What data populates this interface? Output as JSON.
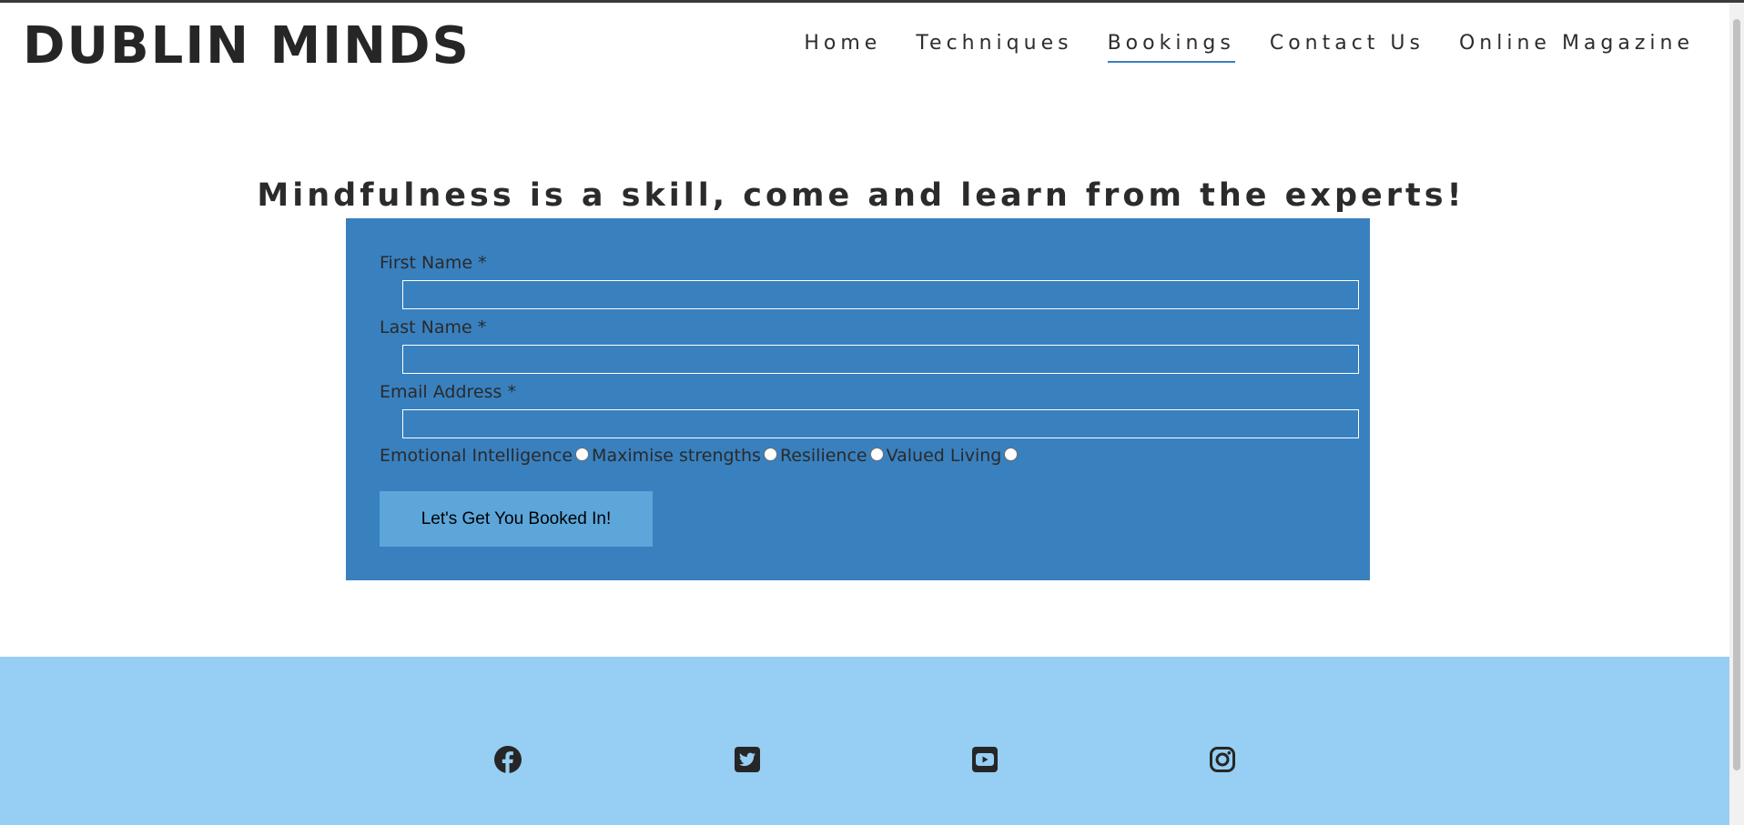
{
  "header": {
    "logo": "DUBLIN MINDS",
    "nav": [
      {
        "label": "Home"
      },
      {
        "label": "Techniques"
      },
      {
        "label": "Bookings",
        "active": true
      },
      {
        "label": "Contact Us"
      },
      {
        "label": "Online Magazine"
      }
    ]
  },
  "main": {
    "headline": "Mindfulness is a skill, come and learn from the experts!",
    "form": {
      "first_name_label": "First Name *",
      "first_name_value": "",
      "last_name_label": "Last Name *",
      "last_name_value": "",
      "email_label": "Email Address *",
      "email_value": "",
      "options": [
        {
          "label": "Emotional Intelligence",
          "checked": false
        },
        {
          "label": "Maximise strengths",
          "checked": false
        },
        {
          "label": "Resilience",
          "checked": false
        },
        {
          "label": "Valued Living",
          "checked": false
        }
      ],
      "submit_label": "Let's Get You Booked In!"
    }
  },
  "footer": {
    "social": [
      {
        "icon": "facebook-icon"
      },
      {
        "icon": "twitter-icon"
      },
      {
        "icon": "youtube-icon"
      },
      {
        "icon": "instagram-icon"
      }
    ]
  },
  "colors": {
    "form_background": "#3980bf",
    "button_background": "#5ca6da",
    "footer_background": "#97cef3",
    "nav_active_underline": "#3a7fc0",
    "text": "#2b2b2b"
  }
}
